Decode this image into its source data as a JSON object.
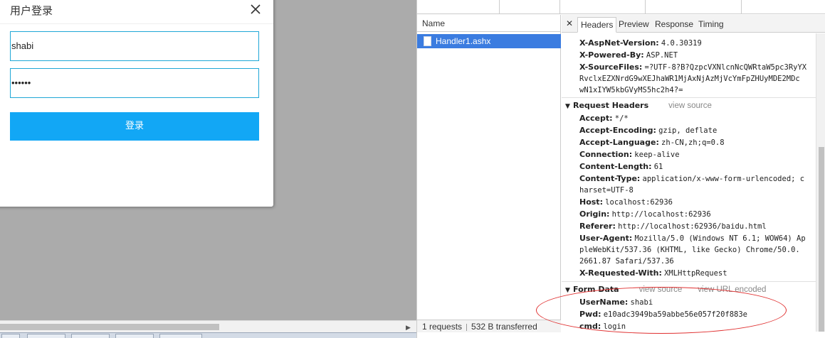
{
  "login_dialog": {
    "title": "用户登录",
    "username_value": "shabi",
    "password_value": "••••••",
    "login_label": "登录"
  },
  "devtools": {
    "name_column_header": "Name",
    "request_name": "Handler1.ashx",
    "status": {
      "requests": "1 requests",
      "transferred": "532 B transferred"
    },
    "tabs": [
      "Headers",
      "Preview",
      "Response",
      "Timing"
    ],
    "response_headers_tail": [
      {
        "name": "X-AspNet-Version:",
        "value": "4.0.30319"
      },
      {
        "name": "X-Powered-By:",
        "value": "ASP.NET"
      },
      {
        "name": "X-SourceFiles:",
        "value": "=?UTF-8?B?QzpcVXNlcnNcQWRtaW5pc3RyYX"
      }
    ],
    "source_files_cont": [
      "RvclxEZXNrdG9wXEJhaWR1MjAxNjAzMjVcYmFpZHUyMDE2MDc",
      "wN1xIYW5kbGVyMS5hc2h4?="
    ],
    "request_headers": {
      "title": "Request Headers",
      "view_source": "view source",
      "items": [
        {
          "name": "Accept:",
          "value": "*/*"
        },
        {
          "name": "Accept-Encoding:",
          "value": "gzip, deflate"
        },
        {
          "name": "Accept-Language:",
          "value": "zh-CN,zh;q=0.8"
        },
        {
          "name": "Connection:",
          "value": "keep-alive"
        },
        {
          "name": "Content-Length:",
          "value": "61"
        },
        {
          "name": "Content-Type:",
          "value": "application/x-www-form-urlencoded; c"
        },
        {
          "name": "Host:",
          "value": "localhost:62936"
        },
        {
          "name": "Origin:",
          "value": "http://localhost:62936"
        },
        {
          "name": "Referer:",
          "value": "http://localhost:62936/baidu.html"
        },
        {
          "name": "User-Agent:",
          "value": "Mozilla/5.0 (Windows NT 6.1; WOW64) Ap"
        },
        {
          "name": "X-Requested-With:",
          "value": "XMLHttpRequest"
        }
      ],
      "content_type_cont": "harset=UTF-8",
      "user_agent_cont": [
        "pleWebKit/537.36 (KHTML, like Gecko) Chrome/50.0.",
        "2661.87 Safari/537.36"
      ]
    },
    "form_data": {
      "title": "Form Data",
      "view_source": "view source",
      "view_url_encoded": "view URL encoded",
      "items": [
        {
          "name": "UserName:",
          "value": "shabi"
        },
        {
          "name": "Pwd:",
          "value": "e10adc3949ba59abbe56e057f20f883e"
        },
        {
          "name": "cmd:",
          "value": "login"
        }
      ]
    }
  },
  "colors": {
    "accent": "#12a7f5",
    "selected_row": "#3b7ce0",
    "annotation": "#e03030"
  }
}
